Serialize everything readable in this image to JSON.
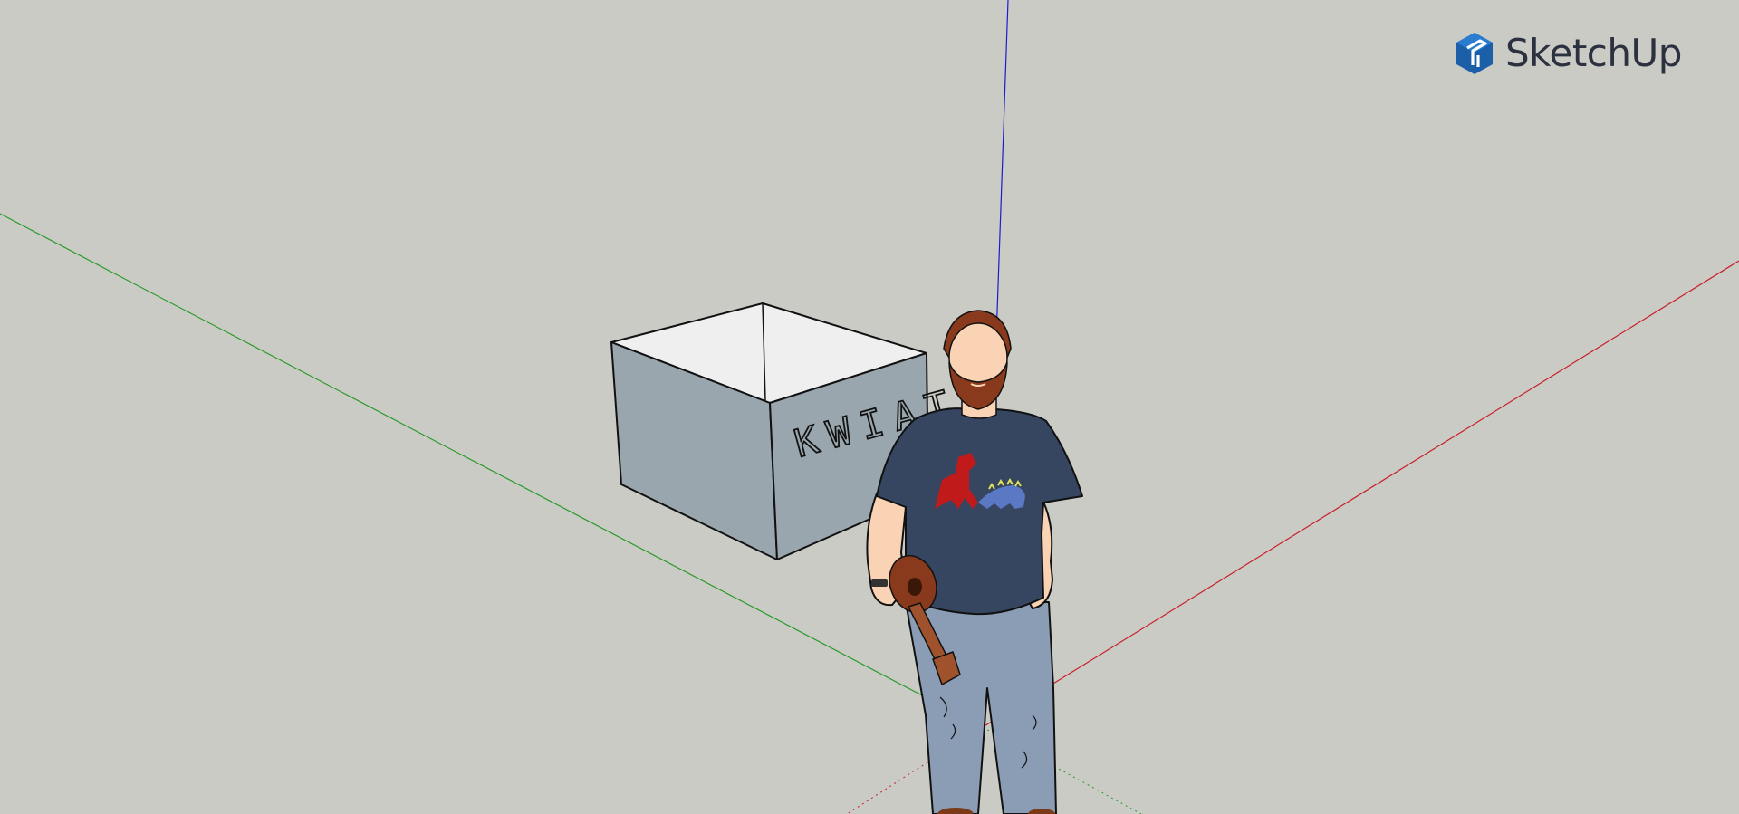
{
  "app": {
    "brand_name": "SketchUp",
    "brand_icon": "sketchup-logo-icon",
    "brand_color": "#1a5fa8",
    "background_color": "#cbcbc6"
  },
  "scene": {
    "box_label": "KWIATY",
    "axes": {
      "red_axis_color": "#c8202a",
      "green_axis_color": "#2a9a2a",
      "blue_axis_color": "#1c1ccc"
    },
    "box": {
      "top_color": "#efefef",
      "side_color": "#9aa6ae"
    },
    "figure": {
      "name": "scale-figure",
      "shirt_color": "#364661",
      "pants_color": "#8b9db4",
      "hair_color": "#8a3a1c"
    }
  }
}
